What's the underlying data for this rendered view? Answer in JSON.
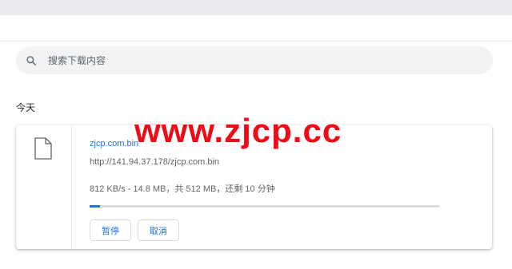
{
  "search": {
    "placeholder": "搜索下载内容",
    "icon": "search-icon"
  },
  "section": {
    "date_label": "今天"
  },
  "download": {
    "icon": "file-icon",
    "file_name": "zjcp.com.bin",
    "url": "http://141.94.37.178/zjcp.com.bin",
    "progress_text": "812 KB/s - 14.8 MB，共 512 MB，还剩 10 分钟",
    "progress_fraction": 0.029,
    "pause_label": "暂停",
    "cancel_label": "取消"
  },
  "watermark": {
    "text": "www.zjcp.cc"
  },
  "colors": {
    "accent": "#1a73e8",
    "watermark": "#ef0a16",
    "search_bg": "#f1f3f4",
    "top_strip": "#eaebee"
  }
}
